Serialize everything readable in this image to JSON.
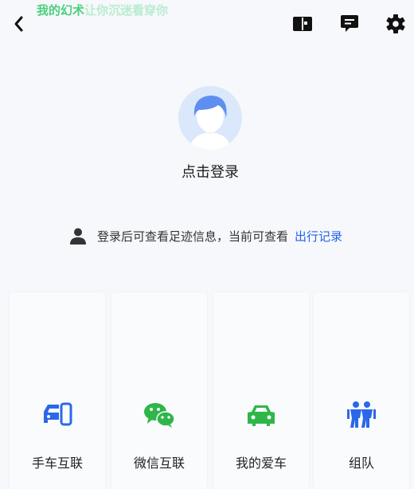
{
  "header": {
    "marquee_primary": "我的幻术",
    "marquee_faded": "让你沉迷看穿你"
  },
  "profile": {
    "login_label": "点击登录"
  },
  "notice": {
    "text": "登录后可查看足迹信息，当前可查看",
    "link_label": "出行记录"
  },
  "cards": [
    {
      "label": "手车互联",
      "icon": "car-phone-icon",
      "color": "#2b68e8"
    },
    {
      "label": "微信互联",
      "icon": "wechat-icon",
      "color": "#2fb64a"
    },
    {
      "label": "我的爱车",
      "icon": "car-icon",
      "color": "#2fb64a"
    },
    {
      "label": "组队",
      "icon": "team-icon",
      "color": "#2b68e8"
    }
  ],
  "colors": {
    "accent_blue": "#2263e6",
    "accent_green": "#2fb64a"
  }
}
